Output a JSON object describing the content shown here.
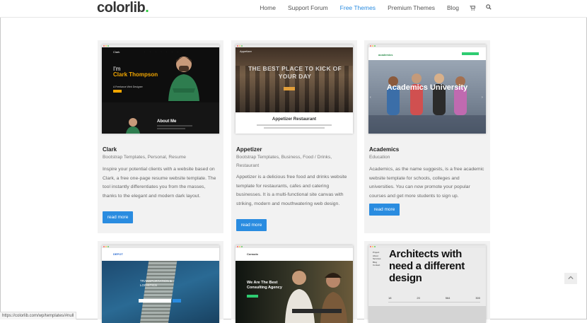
{
  "logo": {
    "text": "colorlib",
    "dot": "."
  },
  "nav": {
    "items": [
      "Home",
      "Support Forum",
      "Free Themes",
      "Premium Themes",
      "Blog"
    ],
    "active": "Free Themes"
  },
  "cards": [
    {
      "title": "Clark",
      "categories": "Bootstrap Templates, Personal, Resume",
      "description": "Inspire your potential clients with a website based on Clark, a free one-page resume website template. The tool instantly differentiates you from the masses, thanks to the elegant and modern dark layout.",
      "button": "read more",
      "thumb": {
        "greeting": "I'm",
        "name": "Clark Thompson",
        "role": "A Freelance Web Designer",
        "section": "About Me",
        "logo": "Clark"
      }
    },
    {
      "title": "Appetizer",
      "categories": "Bootstrap Templates, Business, Food / Drinks, Restaurant",
      "description": "Appetizer is a delicious free food and drinks website template for restaurants, cafes and catering businesses. It is a multi-functional site canvas with striking, modern and mouthwatering web design.",
      "button": "read more",
      "thumb": {
        "headline": "THE BEST PLACE TO KICK OF YOUR DAY",
        "caption": "Appetizer Restaurant",
        "logo": "Appetizer"
      }
    },
    {
      "title": "Academics",
      "categories": "Education",
      "description": "Academics, as the name suggests, is a free academic website template for schools, colleges and universities. You can now promote your popular courses and get more students to sign up.",
      "button": "read more",
      "thumb": {
        "headline": "Academics University",
        "logo": "academics"
      }
    },
    {
      "thumb": {
        "headline": "TRANSPORTATION & LOGISTICS",
        "logo": "DEPOT"
      }
    },
    {
      "thumb": {
        "headline": "We Are The Best Consulting Agency",
        "logo": "Consulo"
      }
    },
    {
      "thumb": {
        "headline": "Architects with need a different design",
        "menu": [
          "Project",
          "About",
          "Services",
          "Blog",
          "Contact"
        ],
        "stats": [
          "18",
          "20",
          "564",
          "300"
        ]
      }
    }
  ],
  "status_url": "https://colorlib.com/wp/templates/#null",
  "colors": {
    "accent": "#2a8ce0",
    "logo_dot": "#2ecc40",
    "card_bg": "#f2f2f2"
  }
}
